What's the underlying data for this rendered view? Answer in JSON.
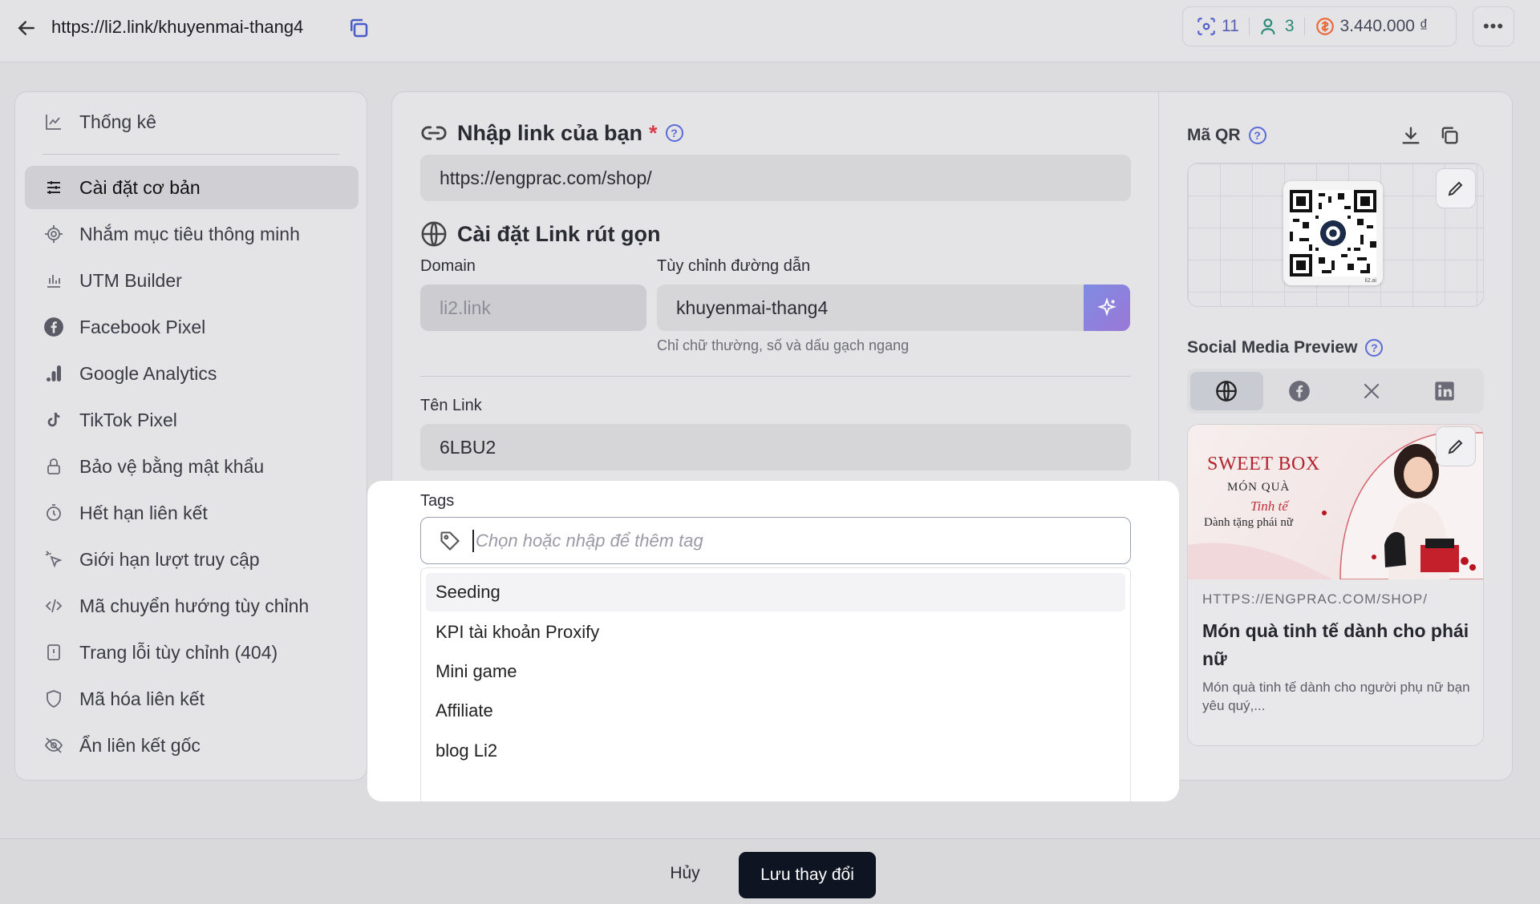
{
  "topbar": {
    "url": "https://li2.link/khuyenmai-thang4",
    "clicks": "11",
    "users": "3",
    "money": "3.440.000 ₫",
    "more": "•••"
  },
  "sidebar": {
    "items": [
      {
        "label": "Thống kê",
        "icon": "chart-icon"
      },
      {
        "label": "Cài đặt cơ bản",
        "icon": "sliders-icon"
      },
      {
        "label": "Nhắm mục tiêu thông minh",
        "icon": "target-icon"
      },
      {
        "label": "UTM Builder",
        "icon": "bar-chart-icon"
      },
      {
        "label": "Facebook Pixel",
        "icon": "facebook-icon"
      },
      {
        "label": "Google Analytics",
        "icon": "analytics-icon"
      },
      {
        "label": "TikTok Pixel",
        "icon": "tiktok-icon"
      },
      {
        "label": "Bảo vệ bằng mật khẩu",
        "icon": "lock-icon"
      },
      {
        "label": "Hết hạn liên kết",
        "icon": "timer-icon"
      },
      {
        "label": "Giới hạn lượt truy cập",
        "icon": "cursor-click-icon"
      },
      {
        "label": "Mã chuyển hướng tùy chỉnh",
        "icon": "code-icon"
      },
      {
        "label": "Trang lỗi tùy chỉnh (404)",
        "icon": "error-page-icon"
      },
      {
        "label": "Mã hóa liên kết",
        "icon": "shield-icon"
      },
      {
        "label": "Ẩn liên kết gốc",
        "icon": "eye-off-icon"
      }
    ]
  },
  "form": {
    "link_title": "Nhập link của bạn",
    "required_mark": "*",
    "link_value": "https://engprac.com/shop/",
    "short_title": "Cài đặt Link rút gọn",
    "domain_label": "Domain",
    "domain_value": "li2.link",
    "path_label": "Tùy chỉnh đường dẫn",
    "path_value": "khuyenmai-thang4",
    "path_hint": "Chỉ chữ thường, số và dấu gạch ngang",
    "name_label": "Tên Link",
    "name_value": "6LBU2",
    "tags_label": "Tags",
    "tags_placeholder": "Chọn hoặc nhập để thêm tag",
    "tag_options": [
      "Seeding",
      "KPI tài khoản Proxify",
      "Mini game",
      "Affiliate",
      "blog Li2"
    ]
  },
  "right": {
    "qr_title": "Mã QR",
    "qr_brand": "li2.ai",
    "social_title": "Social Media Preview",
    "preview": {
      "brand": "SWEET BOX",
      "brand_line1": "MÓN QUÀ",
      "brand_line2": "Tinh tế",
      "brand_line3": "Dành tặng phái nữ",
      "url": "HTTPS://ENGPRAC.COM/SHOP/",
      "title": "Món quà tinh tế dành cho phái nữ",
      "description": "Món quà tinh tế dành cho người phụ nữ bạn yêu quý,..."
    }
  },
  "footer": {
    "cancel_label": "Hủy",
    "save_label": "Lưu thay đổi"
  },
  "colors": {
    "accent": "#5a6bd6",
    "primary_button": "#0e1422",
    "required": "#d9384a",
    "coin": "#e8693a"
  }
}
